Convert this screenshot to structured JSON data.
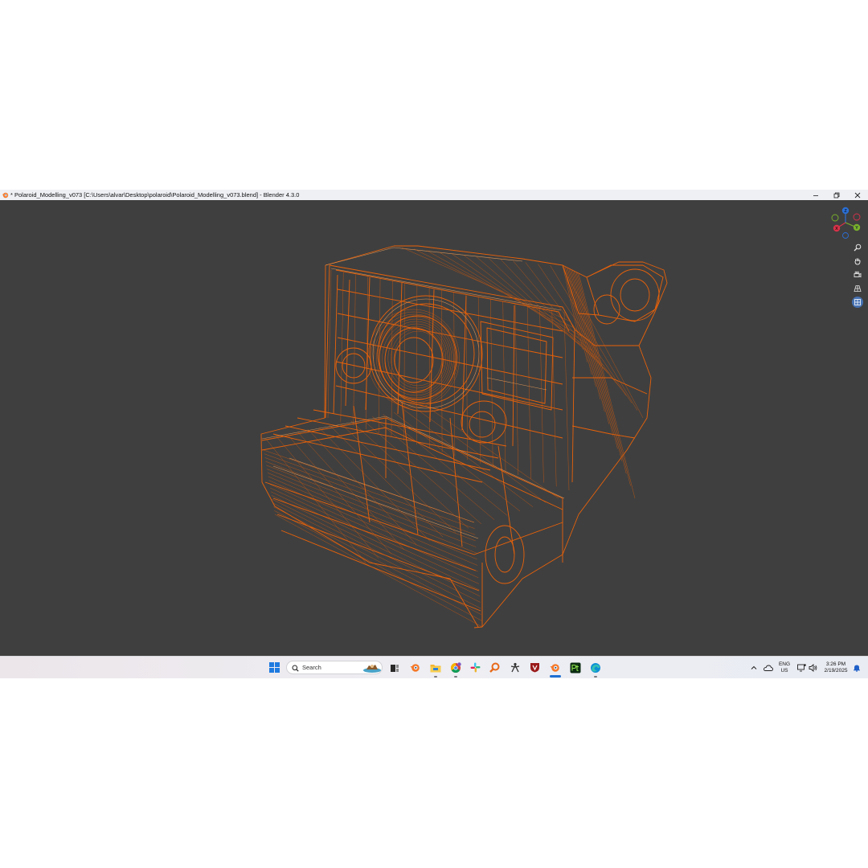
{
  "window": {
    "title": "* Polaroid_Modelling_v073 [C:\\Users\\alvar\\Desktop\\polaroid\\Polaroid_Modelling_v073.blend] - Blender 4.3.0",
    "controls": [
      "minimize-icon",
      "restore-icon",
      "close-icon"
    ]
  },
  "viewport": {
    "background_color": "#3f3f3f",
    "wire_color": "#e8620a",
    "shading": "wireframe",
    "gizmo": {
      "axes": [
        "X",
        "Y",
        "Z"
      ]
    },
    "nav_tools": [
      "zoom-icon",
      "hand-pan-icon",
      "camera-view-icon",
      "perspective-grid-icon",
      "ortho-grid-icon"
    ]
  },
  "taskbar": {
    "search_placeholder": "Search",
    "apps": [
      "windows-start-icon",
      "search-icon",
      "task-view-icon",
      "blender-icon",
      "file-explorer-icon",
      "chrome-icon",
      "slack-icon",
      "search-app-icon",
      "zbrush-icon",
      "davinci-icon",
      "blender-active-icon",
      "substance-painter-icon",
      "edge-icon"
    ],
    "tray": {
      "language": "ENG",
      "region": "US",
      "time": "3:26 PM",
      "date": "2/19/2025"
    }
  }
}
